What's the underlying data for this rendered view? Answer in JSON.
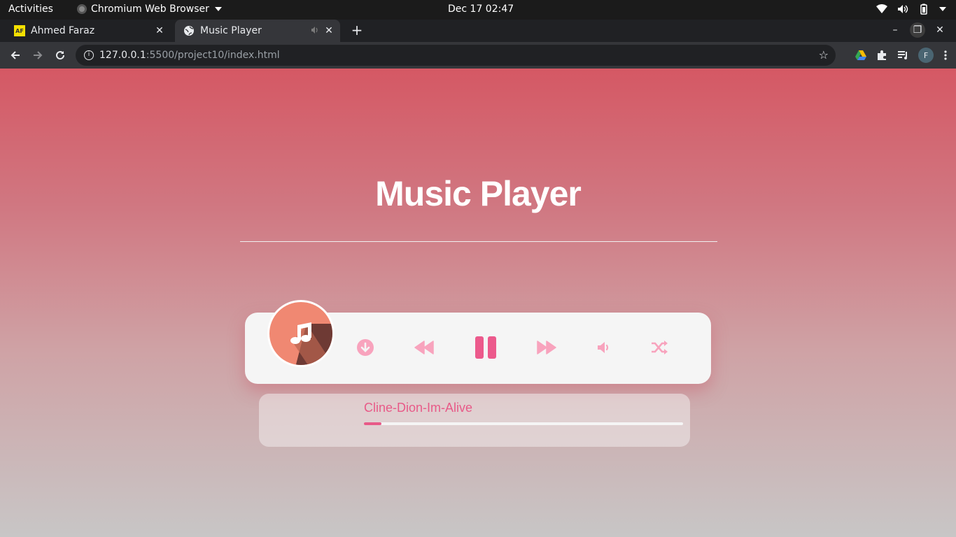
{
  "system": {
    "activities": "Activities",
    "app_name": "Chromium Web Browser",
    "clock": "Dec 17  02:47"
  },
  "tabs": [
    {
      "title": "Ahmed Faraz",
      "favicon": "AF"
    },
    {
      "title": "Music Player"
    }
  ],
  "address": {
    "host": "127.0.0.1",
    "path": ":5500/project10/index.html"
  },
  "profile_initial": "F",
  "page": {
    "heading": "Music Player",
    "song_title": "Cline-Dion-Im-Alive",
    "progress": 0.055,
    "accent_color": "#e85a88",
    "controls": [
      "download-icon",
      "rewind-icon",
      "pause-icon",
      "fast-forward-icon",
      "volume-icon",
      "shuffle-icon"
    ]
  }
}
